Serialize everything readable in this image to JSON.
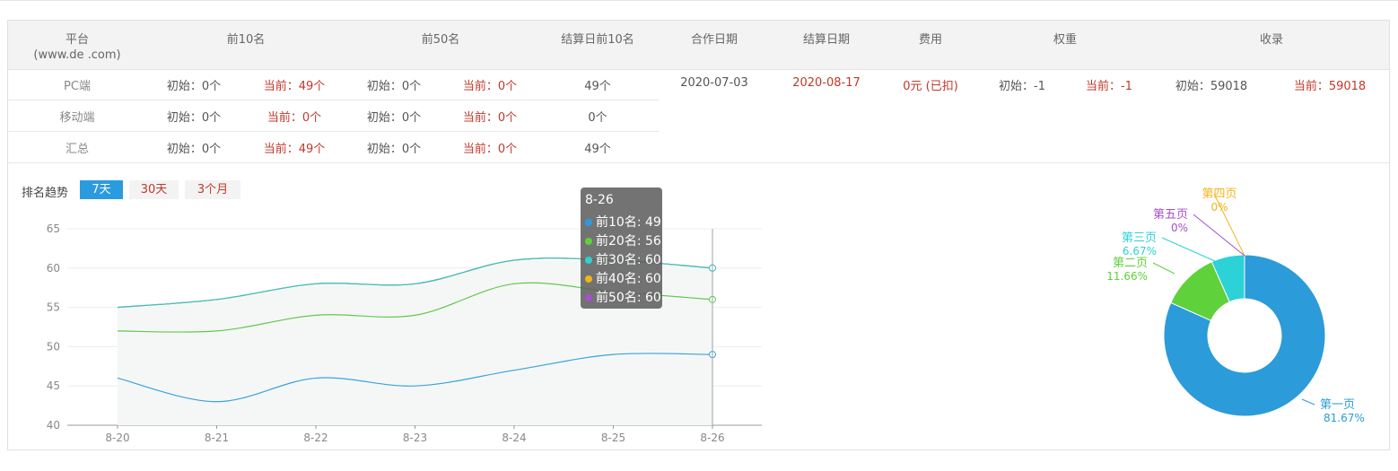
{
  "table": {
    "headers": {
      "platform": "平台",
      "platform_sub": "(www.de          .com)",
      "top10": "前10名",
      "top50": "前50名",
      "settle_top10": "结算日前10名",
      "coop_date": "合作日期",
      "settle_date": "结算日期",
      "fee": "费用",
      "weight": "权重",
      "indexed": "收录"
    },
    "rows": [
      {
        "name": "PC端",
        "top10_init": "初始：0个",
        "top10_cur": "当前：49个",
        "top50_init": "初始：0个",
        "top50_cur": "当前：0个",
        "settle": "49个"
      },
      {
        "name": "移动端",
        "top10_init": "初始：0个",
        "top10_cur": "当前：0个",
        "top50_init": "初始：0个",
        "top50_cur": "当前：0个",
        "settle": "0个"
      },
      {
        "name": "汇总",
        "top10_init": "初始：0个",
        "top10_cur": "当前：49个",
        "top50_init": "初始：0个",
        "top50_cur": "当前：0个",
        "settle": "49个"
      }
    ],
    "coop_date": "2020-07-03",
    "settle_date": "2020-08-17",
    "fee": "0元 (已扣)",
    "weight_init": "初始：-1",
    "weight_cur": "当前：-1",
    "indexed_init": "初始：59018",
    "indexed_cur": "当前：59018"
  },
  "trend": {
    "label": "排名趋势",
    "ranges": [
      "7天",
      "30天",
      "3个月"
    ],
    "active_range": "7天"
  },
  "colors": {
    "blue": "#3aa3dc",
    "green": "#62c94a",
    "teal": "#36c5c9",
    "yellow": "#e7b923",
    "purple": "#a64fd0",
    "red": "#c0392b"
  },
  "tooltip": {
    "title": "8-26",
    "rows": [
      {
        "label": "前10名: 49",
        "color": "#2b9be0"
      },
      {
        "label": "前20名: 56",
        "color": "#5fd13a"
      },
      {
        "label": "前30名: 60",
        "color": "#2dd1d1"
      },
      {
        "label": "前40名: 60",
        "color": "#f2b418"
      },
      {
        "label": "前50名: 60",
        "color": "#a64fd0"
      }
    ]
  },
  "chart_data": [
    {
      "type": "line",
      "x": [
        "8-20",
        "8-21",
        "8-22",
        "8-23",
        "8-24",
        "8-25",
        "8-26"
      ],
      "ylim": [
        40,
        65
      ],
      "yticks": [
        40,
        45,
        50,
        55,
        60,
        65
      ],
      "series": [
        {
          "name": "前10名",
          "color": "#3aa3dc",
          "values": [
            46,
            43,
            46,
            45,
            47,
            49,
            49
          ]
        },
        {
          "name": "前20名",
          "color": "#62c94a",
          "values": [
            52,
            52,
            54,
            54,
            58,
            57,
            56
          ]
        },
        {
          "name": "前30名",
          "color": "#36c5c9",
          "values": [
            55,
            56,
            58,
            58,
            61,
            61,
            60
          ]
        },
        {
          "name": "前40名",
          "color": "#e7b923",
          "values": [
            55,
            56,
            58,
            58,
            61,
            61,
            60
          ]
        },
        {
          "name": "前50名",
          "color": "#a64fd0",
          "values": [
            55,
            56,
            58,
            58,
            61,
            61,
            60
          ]
        }
      ]
    },
    {
      "type": "pie",
      "slices": [
        {
          "name": "第一页",
          "label": "81.67%",
          "value": 81.67,
          "color": "#2b9bd9"
        },
        {
          "name": "第二页",
          "label": "11.66%",
          "value": 11.66,
          "color": "#5fd13a"
        },
        {
          "name": "第三页",
          "label": "6.67%",
          "value": 6.67,
          "color": "#2dd1d8"
        },
        {
          "name": "第四页",
          "label": "0%",
          "value": 0,
          "color": "#f2b418"
        },
        {
          "name": "第五页",
          "label": "0%",
          "value": 0,
          "color": "#a64fd0"
        }
      ]
    }
  ]
}
